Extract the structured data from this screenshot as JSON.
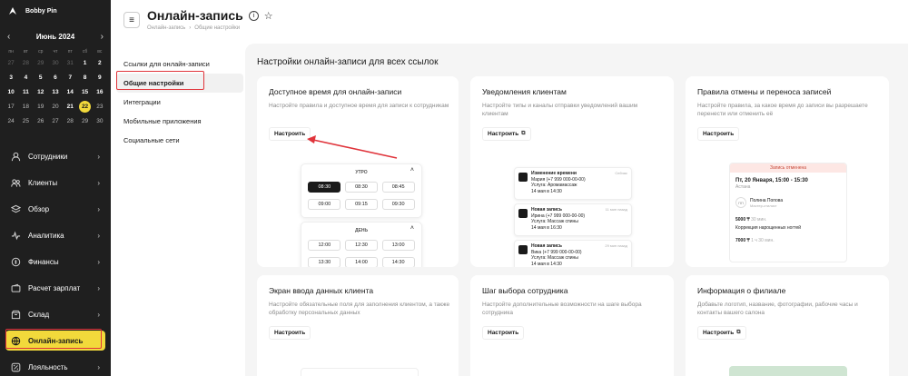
{
  "brand": {
    "name": "Bobby Pin"
  },
  "calendar": {
    "month": "Июнь 2024",
    "weekdays": [
      "пн",
      "вт",
      "ср",
      "чт",
      "пт",
      "сб",
      "вс"
    ],
    "days": [
      {
        "d": "27",
        "k": "muted"
      },
      {
        "d": "28",
        "k": "muted"
      },
      {
        "d": "29",
        "k": "muted"
      },
      {
        "d": "30",
        "k": "muted"
      },
      {
        "d": "31",
        "k": "muted"
      },
      {
        "d": "1",
        "k": "b"
      },
      {
        "d": "2",
        "k": "b"
      },
      {
        "d": "3",
        "k": "b"
      },
      {
        "d": "4",
        "k": "b"
      },
      {
        "d": "5",
        "k": "b"
      },
      {
        "d": "6",
        "k": "b"
      },
      {
        "d": "7",
        "k": "b"
      },
      {
        "d": "8",
        "k": "b"
      },
      {
        "d": "9",
        "k": "b"
      },
      {
        "d": "10",
        "k": "b"
      },
      {
        "d": "11",
        "k": "b"
      },
      {
        "d": "12",
        "k": "b"
      },
      {
        "d": "13",
        "k": "b"
      },
      {
        "d": "14",
        "k": "b"
      },
      {
        "d": "15",
        "k": "b"
      },
      {
        "d": "16",
        "k": "b"
      },
      {
        "d": "17",
        "k": "past"
      },
      {
        "d": "18",
        "k": "past"
      },
      {
        "d": "19",
        "k": "past"
      },
      {
        "d": "20",
        "k": "past"
      },
      {
        "d": "21",
        "k": "b"
      },
      {
        "d": "22",
        "k": "today"
      },
      {
        "d": "23",
        "k": "past"
      },
      {
        "d": "24",
        "k": "past"
      },
      {
        "d": "25",
        "k": "past"
      },
      {
        "d": "26",
        "k": "past"
      },
      {
        "d": "27",
        "k": "past"
      },
      {
        "d": "28",
        "k": "past"
      },
      {
        "d": "29",
        "k": "past"
      },
      {
        "d": "30",
        "k": "past"
      }
    ]
  },
  "nav": [
    {
      "label": "Сотрудники",
      "icon": "user-icon"
    },
    {
      "label": "Клиенты",
      "icon": "users-icon"
    },
    {
      "label": "Обзор",
      "icon": "layers-icon"
    },
    {
      "label": "Аналитика",
      "icon": "pulse-icon"
    },
    {
      "label": "Финансы",
      "icon": "coin-icon"
    },
    {
      "label": "Расчет зарплат",
      "icon": "wallet-icon"
    },
    {
      "label": "Склад",
      "icon": "box-icon"
    },
    {
      "label": "Онлайн-запись",
      "icon": "globe-icon",
      "active": true
    },
    {
      "label": "Лояльность",
      "icon": "percent-icon"
    }
  ],
  "header": {
    "title": "Онлайн-запись",
    "crumb1": "Онлайн-запись",
    "crumb2": "Общие настройки"
  },
  "leftmenu": [
    "Ссылки для онлайн-записи",
    "Общие настройки",
    "Интеграции",
    "Мобильные приложения",
    "Социальные сети"
  ],
  "section_title": "Настройки онлайн-записи для всех ссылок",
  "configure": "Настроить",
  "cards": [
    {
      "title": "Доступное время для онлайн-записи",
      "desc": "Настройте правила и доступное время для записи к сотрудникам"
    },
    {
      "title": "Уведомления клиентам",
      "desc": "Настройте типы и каналы отправки уведомлений вашим клиентам"
    },
    {
      "title": "Правила отмены и переноса записей",
      "desc": "Настройте правила, за какое время до записи вы разрешаете перенести или отменить её"
    },
    {
      "title": "Экран ввода данных клиента",
      "desc": "Настройте обязательные поля для заполнения клиентом, а также обработку персональных данных"
    },
    {
      "title": "Шаг выбора сотрудника",
      "desc": "Настройте дополнительные возможности на шаге выбора сотрудника"
    },
    {
      "title": "Информация о филиале",
      "desc": "Добавьте логотип, название, фотографии, рабочие часы и контакты вашего салона"
    }
  ],
  "timepicker": {
    "morning": "УТРО",
    "day": "ДЕНЬ",
    "m1": [
      "08:30",
      "08:45"
    ],
    "mrow1": [
      "08:30",
      "08:45"
    ],
    "morning_slots": [
      [
        "08:30",
        "08:30",
        "08:45"
      ],
      [
        "09:00",
        "09:15",
        "09:30"
      ]
    ],
    "day_slots": [
      [
        "12:00",
        "12:30",
        "13:00"
      ],
      [
        "13:30",
        "14:00",
        "14:30"
      ]
    ]
  },
  "notifications": [
    {
      "title": "Изменение времени",
      "time": "Сейчас",
      "l1": "Мария (+7 999 000-00-00)",
      "l2": "Услуга: Аромамассаж",
      "l3": "14 мая в 14:30"
    },
    {
      "title": "Новая запись",
      "time": "11 мин назад",
      "l1": "Ирина (+7 999 000-00-00)",
      "l2": "Услуга: Массаж спины",
      "l3": "14 мая в 16:30"
    },
    {
      "title": "Новая запись",
      "time": "29 мин назад",
      "l1": "Вика (+7 999 000-00-00)",
      "l2": "Услуга: Массаж спины",
      "l3": "14 мая в 14:30"
    }
  ],
  "cancel": {
    "bar": "Запись отменена",
    "date": "Пт, 20 Января, 15:00 - 15:30",
    "place": "Астана",
    "initials": "ПП",
    "name": "Полина Попова",
    "role": "Мастер-стилист",
    "p1": "5000 ₸",
    "p1d": "30 мин.",
    "svc": "Коррекция нарощенных ногтей",
    "p2": "7000 ₸",
    "p2d": "1 ч 30 мин."
  },
  "colors": {
    "accent": "#f2d93b",
    "highlight": "#e0343b",
    "sidebar": "#1f1f1f"
  }
}
